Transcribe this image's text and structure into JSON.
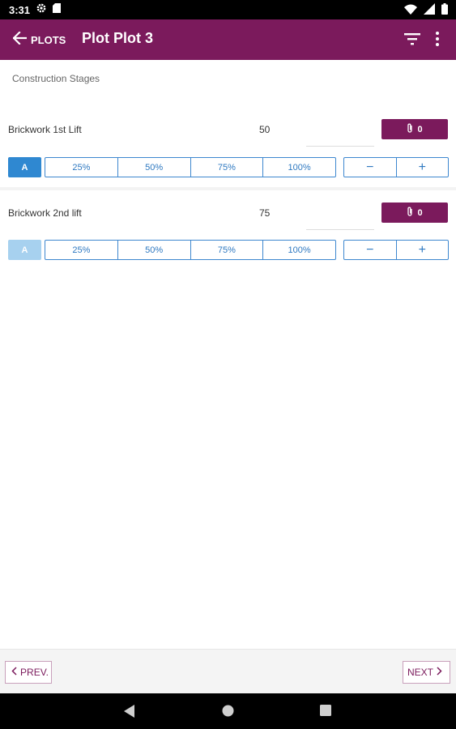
{
  "status_bar": {
    "time": "3:31",
    "icons": [
      "gear-icon",
      "sd-card-icon",
      "wifi-icon",
      "signal-icon",
      "battery-icon"
    ]
  },
  "app_bar": {
    "back_label": "PLOTS",
    "title": "Plot Plot 3",
    "color": "#7b1a5c"
  },
  "section_label": "Construction Stages",
  "stages": [
    {
      "name": "Brickwork 1st Lift",
      "value": "50",
      "attachment_count": "0",
      "a_label": "A",
      "a_state": "active",
      "percentages": [
        "25%",
        "50%",
        "75%",
        "100%"
      ],
      "minus": "−",
      "plus": "+"
    },
    {
      "name": "Brickwork 2nd lift",
      "value": "75",
      "attachment_count": "0",
      "a_label": "A",
      "a_state": "faded",
      "percentages": [
        "25%",
        "50%",
        "75%",
        "100%"
      ],
      "minus": "−",
      "plus": "+"
    }
  ],
  "bottom_nav": {
    "prev_label": "PREV.",
    "next_label": "NEXT"
  },
  "system_nav": {
    "icons": [
      "back-triangle-icon",
      "home-circle-icon",
      "recents-square-icon"
    ]
  }
}
